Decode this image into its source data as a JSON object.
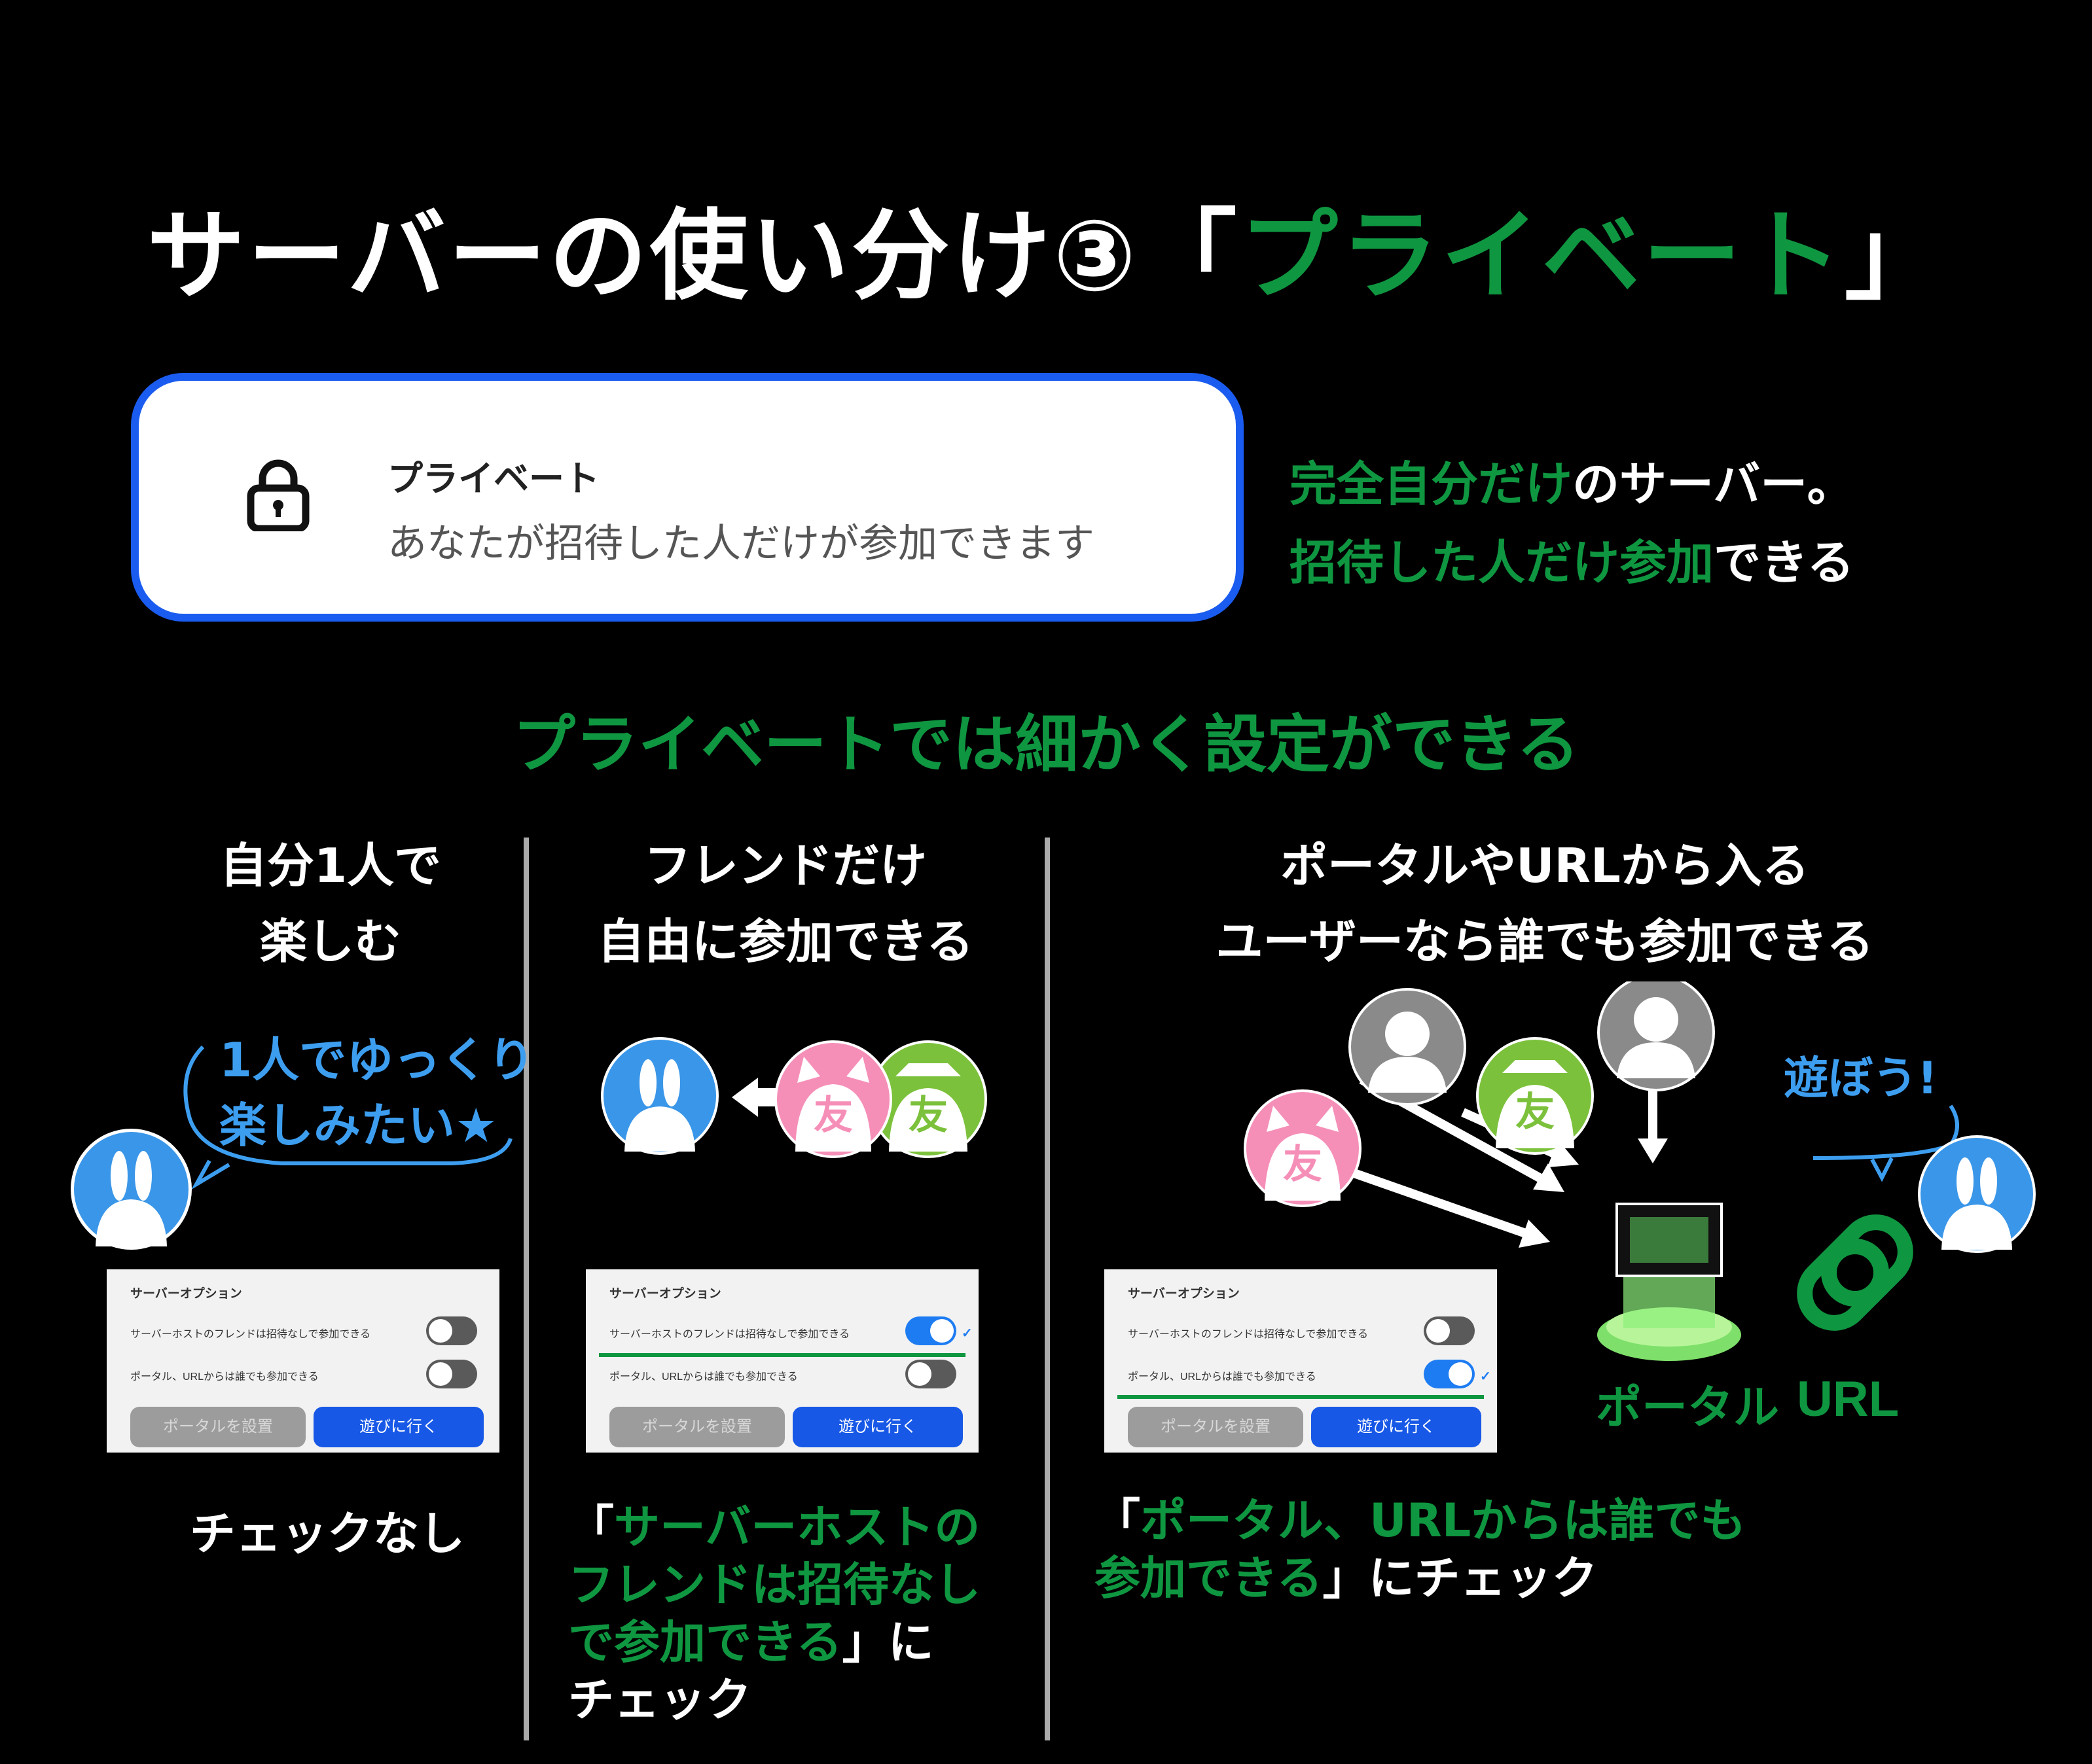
{
  "title": {
    "prefix": "サーバーの使い分け③「",
    "highlight": "プライベート",
    "suffix": "」"
  },
  "private_card": {
    "title": "プライベート",
    "description": "あなたが招待した人だけが参加できます",
    "icon": "lock-icon"
  },
  "side_desc": {
    "line1_green": "完全自分だけ",
    "line1_white": "のサーバー。",
    "line2_green": "招待した人だけ参加",
    "line2_white": "できる"
  },
  "subtitle": "プライベートでは細かく設定ができる",
  "panel_common": {
    "header": "サーバーオプション",
    "option1": "サーバーホストのフレンドは招待なしで参加できる",
    "option2": "ポータル、URLからは誰でも参加できる",
    "button_portal": "ポータルを設置",
    "button_go": "遊びに行く"
  },
  "columns": [
    {
      "heading_line1": "自分1人で",
      "heading_line2": "楽しむ",
      "bubble_line1": "1人でゆっくり",
      "bubble_line2": "楽しみたい★",
      "option1_on": false,
      "option2_on": false,
      "caption": "チェックなし"
    },
    {
      "heading_line1": "フレンドだけ",
      "heading_line2": "自由に参加できる",
      "friend_label": "友",
      "option1_on": true,
      "option2_on": false,
      "caption_open": "「",
      "caption_green_1": "サーバーホストの",
      "caption_green_2": "フレンドは招待なし",
      "caption_green_3": "で参加できる",
      "caption_close": "」に",
      "caption_end": "チェック"
    },
    {
      "heading_line1": "ポータルやURLから入る",
      "heading_line2": "ユーザーなら誰でも参加できる",
      "friend_label": "友",
      "bubble": "遊ぼう!",
      "portal_label": "ポータル",
      "url_label": "URL",
      "option1_on": false,
      "option2_on": true,
      "caption_open": "「",
      "caption_green_1": "ポータル、URLからは誰でも",
      "caption_green_2": "参加できる",
      "caption_close": "」にチェック"
    }
  ],
  "colors": {
    "green": "#0f9640",
    "accent_blue": "#3d9ef0",
    "card_border": "#1b5cf0",
    "pink": "#f58fb8",
    "lime": "#7cc13c"
  }
}
